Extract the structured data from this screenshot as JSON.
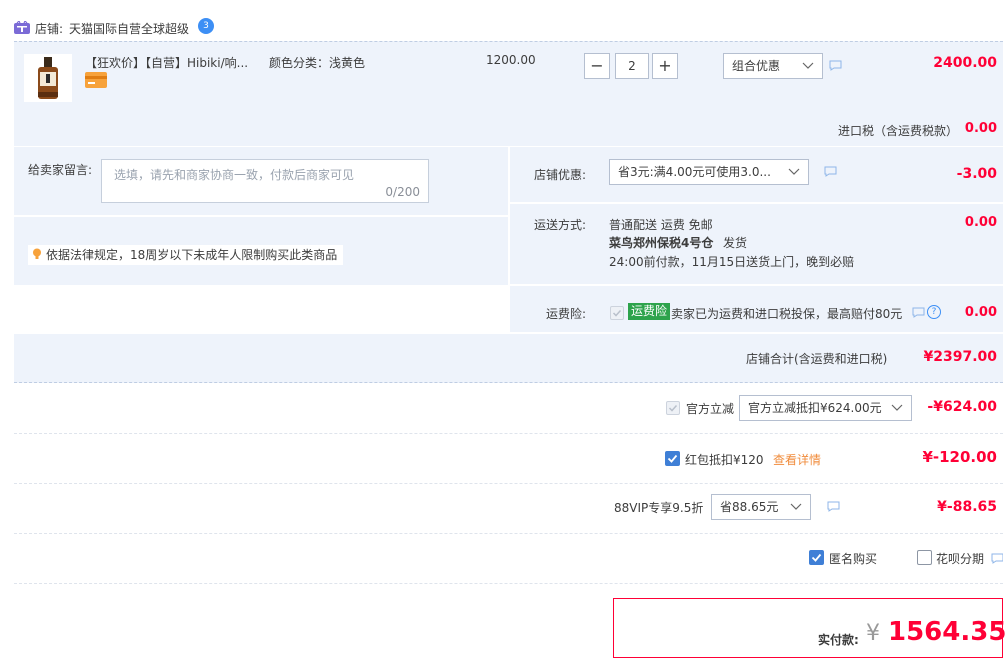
{
  "shop": {
    "label": "店铺:",
    "name": "天猫国际自营全球超级",
    "badge": "3"
  },
  "item": {
    "title": "【狂欢价】【自营】Hibiki/响...",
    "sku": "颜色分类：浅黄色",
    "price": "1200.00",
    "minus": "−",
    "qty": "2",
    "plus": "+",
    "promo_select": "组合优惠",
    "total": "2400.00"
  },
  "tax": {
    "label": "进口税（含运费税款）",
    "value": "0.00"
  },
  "message": {
    "label": "给卖家留言:",
    "placeholder": "选填，请先和商家协商一致，付款后商家可见",
    "counter": "0/200"
  },
  "legal_notice": "依据法律规定，18周岁以下未成年人限制购买此类商品",
  "store_coupon": {
    "label": "店铺优惠:",
    "selected": "省3元:满4.00元可使用3.0...",
    "value": "-3.00"
  },
  "shipping": {
    "label": "运送方式:",
    "line1": "普通配送 运费 免邮",
    "warehouse": "菜鸟郑州保税4号仓",
    "dispatch": "发货",
    "line3": "24:00前付款，11月15日送货上门，晚到必赔",
    "value": "0.00"
  },
  "insurance": {
    "label": "运费险:",
    "tag": "运费险",
    "text": "卖家已为运费和进口税投保，最高赔付80元",
    "value": "0.00"
  },
  "shop_total": {
    "label": "店铺合计(含运费和进口税)",
    "value": "¥2397.00"
  },
  "official_discount": {
    "label": "官方立减",
    "selected": "官方立减抵扣¥624.00元",
    "value": "-¥624.00"
  },
  "red_packet": {
    "label": "红包抵扣¥120",
    "link": "查看详情",
    "value": "¥-120.00"
  },
  "vip": {
    "label": "88VIP专享9.5折",
    "selected": "省88.65元",
    "value": "¥-88.65"
  },
  "options": {
    "anonymous": "匿名购买",
    "installment": "花呗分期"
  },
  "payment": {
    "label": "实付款:",
    "currency": "¥",
    "amount": "1564.35"
  },
  "colors": {
    "accent_red": "#ff0036",
    "panel_blue": "#eef3fb",
    "tag_green": "#2ea34c",
    "checkbox_blue": "#3f7fd6",
    "link_orange": "#f08c3c"
  }
}
